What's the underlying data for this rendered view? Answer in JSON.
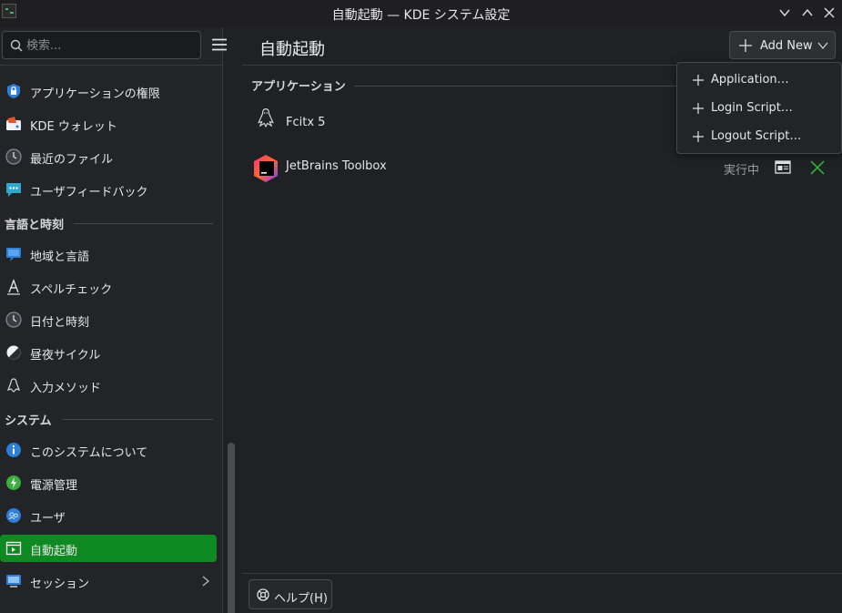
{
  "window": {
    "title": "自動起動 — KDE システム設定"
  },
  "sidebar": {
    "search_placeholder": "検索...",
    "items_top": [
      {
        "label": "アプリケーションの権限",
        "icon": "shield-lock-icon"
      },
      {
        "label": "KDE ウォレット",
        "icon": "wallet-icon"
      },
      {
        "label": "最近のファイル",
        "icon": "clock-icon"
      },
      {
        "label": "ユーザフィードバック",
        "icon": "feedback-chat-icon"
      }
    ],
    "section_language": "言語と時刻",
    "items_language": [
      {
        "label": "地域と言語",
        "icon": "region-flag-icon"
      },
      {
        "label": "スペルチェック",
        "icon": "spellcheck-icon"
      },
      {
        "label": "日付と時刻",
        "icon": "clock-icon"
      },
      {
        "label": "昼夜サイクル",
        "icon": "day-night-icon"
      },
      {
        "label": "入力メソッド",
        "icon": "input-method-icon"
      }
    ],
    "section_system": "システム",
    "items_system": [
      {
        "label": "このシステムについて",
        "icon": "info-icon"
      },
      {
        "label": "電源管理",
        "icon": "power-icon"
      },
      {
        "label": "ユーザ",
        "icon": "users-icon"
      },
      {
        "label": "自動起動",
        "icon": "autostart-icon",
        "active": true
      },
      {
        "label": "セッション",
        "icon": "session-icon"
      }
    ]
  },
  "main": {
    "title": "自動起動",
    "add_new_label": "Add New",
    "section_apps": "アプリケーション",
    "apps": [
      {
        "name": "Fcitx 5",
        "icon": "fcitx-penguin-icon",
        "status": ""
      },
      {
        "name": "JetBrains Toolbox",
        "icon": "jetbrains-toolbox-icon",
        "status": "実行中"
      }
    ],
    "help_label": "ヘルプ(H)"
  },
  "add_menu": {
    "items": [
      "Application…",
      "Login Script…",
      "Logout Script…"
    ]
  },
  "colors": {
    "accent": "#0f8a23",
    "background": "#202124",
    "sidebar": "#232427",
    "remove_icon": "#2fae3a"
  }
}
